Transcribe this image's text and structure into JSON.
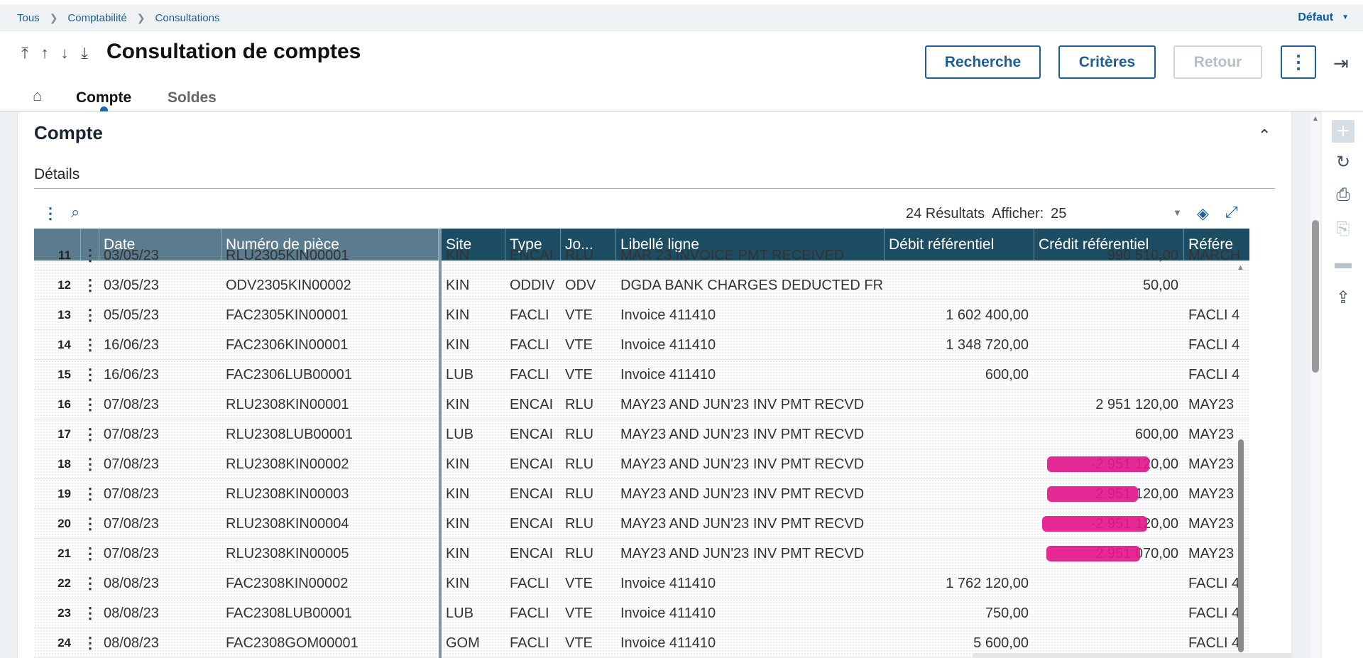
{
  "breadcrumb": {
    "items": [
      "Tous",
      "Comptabilité",
      "Consultations"
    ],
    "right": "Défaut"
  },
  "header": {
    "title": "Consultation de comptes",
    "buttons": {
      "recherche": "Recherche",
      "criteres": "Critères",
      "retour": "Retour"
    },
    "tabs": [
      "Compte",
      "Soldes"
    ]
  },
  "section": {
    "title": "Compte",
    "subtitle": "Détails"
  },
  "toolbar": {
    "results": "24 Résultats",
    "show_label": "Afficher:",
    "show_value": "25"
  },
  "grid": {
    "columns": [
      "Date",
      "Numéro de pièce",
      "Site",
      "Type",
      "Jo...",
      "Libellé ligne",
      "Débit référentiel",
      "Crédit référentiel",
      "Référe"
    ],
    "rows": [
      {
        "n": "11",
        "date": "03/05/23",
        "piece": "RLU2305KIN00001",
        "site": "KIN",
        "type": "ENCAI",
        "jo": "RLU",
        "libelle": "MAR 23 INVOICE PMT RECEIVED",
        "debit": "",
        "credit": "990 510,00",
        "ref": "MARCH"
      },
      {
        "n": "12",
        "date": "03/05/23",
        "piece": "ODV2305KIN00002",
        "site": "KIN",
        "type": "ODDIV",
        "jo": "ODV",
        "libelle": "DGDA BANK CHARGES DEDUCTED FR",
        "debit": "",
        "credit": "50,00",
        "ref": ""
      },
      {
        "n": "13",
        "date": "05/05/23",
        "piece": "FAC2305KIN00001",
        "site": "KIN",
        "type": "FACLI",
        "jo": "VTE",
        "libelle": "Invoice 411410",
        "debit": "1 602 400,00",
        "credit": "",
        "ref": "FACLI 4"
      },
      {
        "n": "14",
        "date": "16/06/23",
        "piece": "FAC2306KIN00001",
        "site": "KIN",
        "type": "FACLI",
        "jo": "VTE",
        "libelle": "Invoice 411410",
        "debit": "1 348 720,00",
        "credit": "",
        "ref": "FACLI 4"
      },
      {
        "n": "15",
        "date": "16/06/23",
        "piece": "FAC2306LUB00001",
        "site": "LUB",
        "type": "FACLI",
        "jo": "VTE",
        "libelle": "Invoice 411410",
        "debit": "600,00",
        "credit": "",
        "ref": "FACLI 4"
      },
      {
        "n": "16",
        "date": "07/08/23",
        "piece": "RLU2308KIN00001",
        "site": "KIN",
        "type": "ENCAI",
        "jo": "RLU",
        "libelle": "MAY23 AND JUN'23 INV PMT RECVD",
        "debit": "",
        "credit": "2 951 120,00",
        "ref": "MAY23"
      },
      {
        "n": "17",
        "date": "07/08/23",
        "piece": "RLU2308LUB00001",
        "site": "LUB",
        "type": "ENCAI",
        "jo": "RLU",
        "libelle": "MAY23 AND JUN'23 INV PMT RECVD",
        "debit": "",
        "credit": "600,00",
        "ref": "MAY23"
      },
      {
        "n": "18",
        "date": "07/08/23",
        "piece": "RLU2308KIN00002",
        "site": "KIN",
        "type": "ENCAI",
        "jo": "RLU",
        "libelle": "MAY23 AND JUN'23 INV PMT RECVD",
        "debit": "",
        "credit": "-2 951 120,00",
        "ref": "MAY23"
      },
      {
        "n": "19",
        "date": "07/08/23",
        "piece": "RLU2308KIN00003",
        "site": "KIN",
        "type": "ENCAI",
        "jo": "RLU",
        "libelle": "MAY23 AND JUN'23 INV PMT RECVD",
        "debit": "",
        "credit": "2 951 120,00",
        "ref": "MAY23"
      },
      {
        "n": "20",
        "date": "07/08/23",
        "piece": "RLU2308KIN00004",
        "site": "KIN",
        "type": "ENCAI",
        "jo": "RLU",
        "libelle": "MAY23 AND JUN'23 INV PMT RECVD",
        "debit": "",
        "credit": "-2 951 120,00",
        "ref": "MAY23"
      },
      {
        "n": "21",
        "date": "07/08/23",
        "piece": "RLU2308KIN00005",
        "site": "KIN",
        "type": "ENCAI",
        "jo": "RLU",
        "libelle": "MAY23 AND JUN'23 INV PMT RECVD",
        "debit": "",
        "credit": "2 951 070,00",
        "ref": "MAY23"
      },
      {
        "n": "22",
        "date": "08/08/23",
        "piece": "FAC2308KIN00002",
        "site": "KIN",
        "type": "FACLI",
        "jo": "VTE",
        "libelle": "Invoice 411410",
        "debit": "1 762 120,00",
        "credit": "",
        "ref": "FACLI 4"
      },
      {
        "n": "23",
        "date": "08/08/23",
        "piece": "FAC2308LUB00001",
        "site": "LUB",
        "type": "FACLI",
        "jo": "VTE",
        "libelle": "Invoice 411410",
        "debit": "750,00",
        "credit": "",
        "ref": "FACLI 4"
      },
      {
        "n": "24",
        "date": "08/08/23",
        "piece": "FAC2308GOM00001",
        "site": "GOM",
        "type": "FACLI",
        "jo": "VTE",
        "libelle": "Invoice 411410",
        "debit": "5 600,00",
        "credit": "",
        "ref": "FACLI 4"
      }
    ]
  },
  "colors": {
    "header_dark": "#1d4d63",
    "header_light": "#5b7c8e",
    "accent": "#1e5f97",
    "redaction": "#e4188c"
  }
}
